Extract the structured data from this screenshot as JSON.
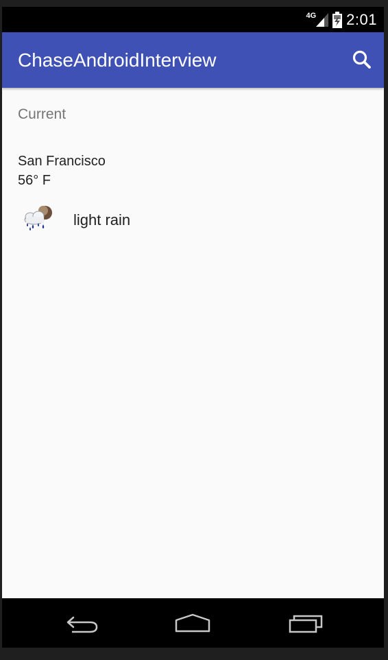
{
  "status_bar": {
    "network": "4G",
    "time": "2:01",
    "icons": [
      "signal-icon",
      "battery-icon"
    ]
  },
  "app_bar": {
    "title": "ChaseAndroidInterview",
    "color": "#3f51b5",
    "search_icon": "search-icon"
  },
  "main": {
    "section_label": "Current",
    "city": "San Francisco",
    "temperature": "56° F",
    "condition_icon": "light-rain-icon",
    "condition": "light rain"
  },
  "nav_bar": {
    "buttons": [
      "back-icon",
      "home-icon",
      "recents-icon"
    ]
  }
}
